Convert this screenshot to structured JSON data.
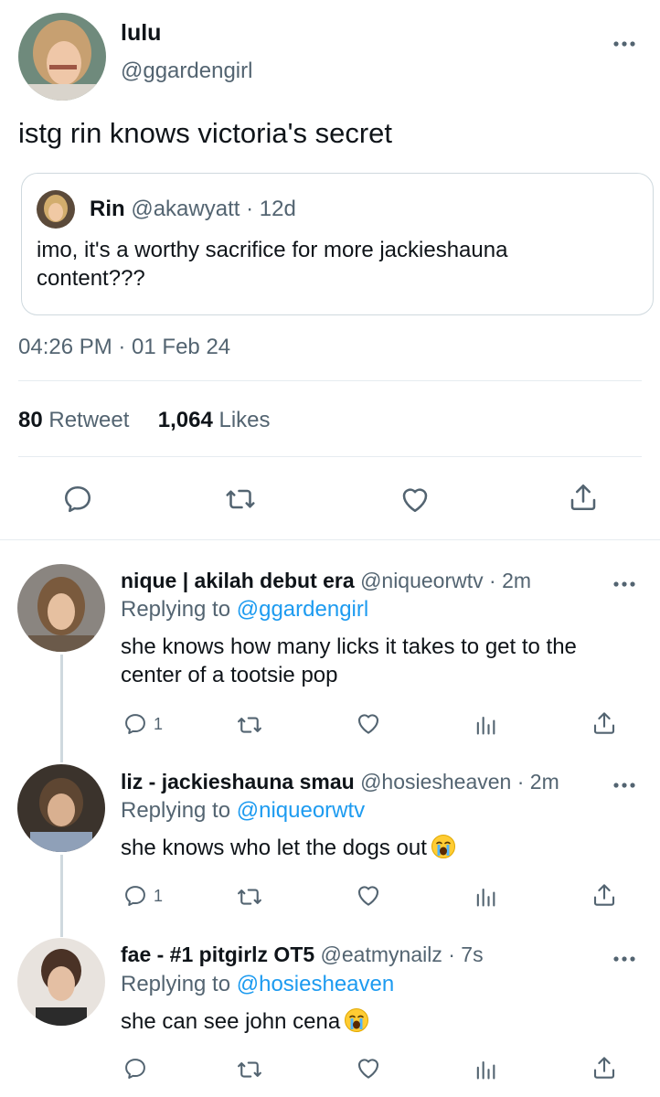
{
  "main_tweet": {
    "author_name": "lulu",
    "author_handle": "@ggardengirl",
    "more_icon": "more-horizontal-icon",
    "text": "istg rin knows victoria's secret",
    "quote": {
      "author_name": "Rin",
      "author_handle": "@akawyatt",
      "time": "· 12d",
      "text": "imo, it's a worthy sacrifice for more jackieshauna content???"
    },
    "timestamp": "04:26 PM · 01 Feb 24",
    "retweet_count": "80",
    "retweet_label": "Retweet",
    "like_count": "1,064",
    "like_label": "Likes",
    "actions": [
      "reply-icon",
      "retweet-icon",
      "heart-icon",
      "share-icon"
    ]
  },
  "replies": [
    {
      "author_name": "nique | akilah debut era",
      "author_handle": "@niqueorwtv",
      "time": "· 2m",
      "replying_prefix": "Replying to",
      "replying_to": "@ggardengirl",
      "text": "she knows how many licks it takes to get to the center of a tootsie pop",
      "reply_count": "1"
    },
    {
      "author_name": "liz - jackieshauna smau",
      "author_handle": "@hosiesheaven",
      "time": "· 2m",
      "replying_prefix": "Replying to",
      "replying_to": "@niqueorwtv",
      "text": "she knows who let the dogs out",
      "emoji": "loudly-crying-face-icon",
      "reply_count": "1"
    },
    {
      "author_name": "fae - #1 pitgirlz OT5",
      "author_handle": "@eatmynailz",
      "time": "· 7s",
      "replying_prefix": "Replying to",
      "replying_to": "@hosiesheaven",
      "text": "she can see john cena",
      "emoji": "loudly-crying-face-icon",
      "reply_count": ""
    }
  ],
  "colors": {
    "text": "#0f1419",
    "secondary": "#536471",
    "link": "#1d9bf0",
    "divider": "#e6ecf0",
    "border": "#cfd9de"
  }
}
